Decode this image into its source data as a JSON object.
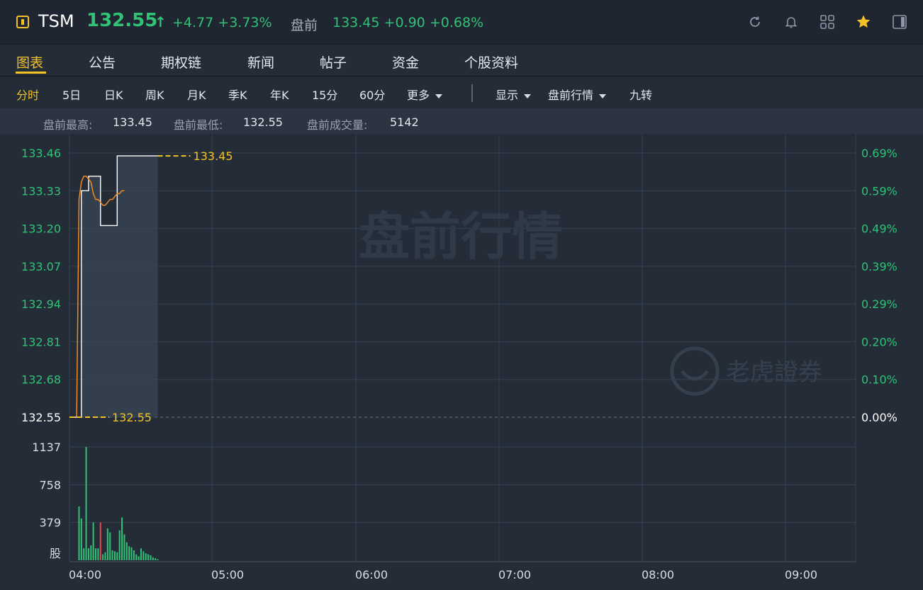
{
  "header": {
    "ticker": "TSM",
    "price": "132.55",
    "arrow": "↑",
    "change": "+4.77",
    "change_pct": "+3.73%",
    "premarket_label": "盘前",
    "premarket_price": "133.45",
    "premarket_change": "+0.90",
    "premarket_change_pct": "+0.68%",
    "icons": [
      "refresh-icon",
      "bell-icon",
      "grid-icon",
      "star-icon",
      "panel-icon"
    ]
  },
  "nav": {
    "tabs": [
      "图表",
      "公告",
      "期权链",
      "新闻",
      "帖子",
      "资金",
      "个股资料"
    ],
    "active": "图表"
  },
  "periods": {
    "items": [
      "分时",
      "5日",
      "日K",
      "周K",
      "月K",
      "季K",
      "年K",
      "15分",
      "60分"
    ],
    "more": "更多",
    "display": "显示",
    "session": "盘前行情",
    "nine_turn": "九转"
  },
  "stats": {
    "high_label": "盘前最高:",
    "high": "133.45",
    "low_label": "盘前最低:",
    "low": "132.55",
    "volume_label": "盘前成交量:",
    "volume": "5142"
  },
  "watermark": {
    "session": "盘前行情",
    "brand": "老虎證券"
  },
  "colors": {
    "up": "#30c275",
    "down": "#e8484e",
    "accent": "#f3c325",
    "price_line": "#ffffff",
    "avg_line": "#f08a24"
  },
  "chart_data": {
    "type": "line",
    "x_ticks": [
      "04:00",
      "05:00",
      "06:00",
      "07:00",
      "08:00",
      "09:00"
    ],
    "x_range": [
      "04:00",
      "09:30"
    ],
    "price_ylim": [
      132.55,
      133.46
    ],
    "price_ticks": [
      "133.46",
      "133.33",
      "133.20",
      "133.07",
      "132.94",
      "132.81",
      "132.68",
      "132.55"
    ],
    "pct_ticks": [
      "0.69%",
      "0.59%",
      "0.49%",
      "0.39%",
      "0.29%",
      "0.20%",
      "0.10%",
      "0.00%"
    ],
    "high_marker": "133.45",
    "low_marker": "132.55",
    "price_series": {
      "x_min": [
        0,
        1,
        3,
        4,
        5,
        7,
        8,
        9,
        13,
        14,
        15,
        19,
        20,
        21,
        22,
        23,
        24,
        25,
        26,
        27,
        28,
        29,
        30,
        31,
        32,
        33,
        34,
        35,
        36,
        37
      ],
      "y": [
        132.55,
        132.55,
        132.55,
        132.55,
        133.33,
        133.33,
        133.38,
        133.38,
        133.21,
        133.21,
        133.21,
        133.21,
        133.45,
        133.45,
        133.45,
        133.45,
        133.45,
        133.45,
        133.45,
        133.45,
        133.45,
        133.45,
        133.45,
        133.45,
        133.45,
        133.45,
        133.45,
        133.45,
        133.45,
        133.45
      ]
    },
    "avg_series": {
      "x_min": [
        3,
        4,
        5,
        6,
        7,
        8,
        9,
        10,
        11,
        12,
        13,
        14,
        15,
        16,
        17,
        18,
        19,
        20,
        21,
        22,
        23
      ],
      "y": [
        132.55,
        133.3,
        133.36,
        133.38,
        133.38,
        133.37,
        133.36,
        133.32,
        133.3,
        133.3,
        133.29,
        133.28,
        133.28,
        133.29,
        133.3,
        133.3,
        133.31,
        133.32,
        133.32,
        133.33,
        133.33
      ]
    },
    "volume_ticks": [
      "1137",
      "758",
      "379"
    ],
    "volume_unit": "股",
    "volume_ylim": [
      0,
      1137
    ],
    "volume": {
      "x_min": [
        3,
        4,
        5,
        6,
        7,
        8,
        9,
        10,
        11,
        12,
        13,
        14,
        15,
        16,
        17,
        18,
        19,
        20,
        21,
        22,
        23,
        24,
        25,
        26,
        27,
        28,
        29,
        30,
        31,
        32,
        33,
        34,
        35,
        36,
        37
      ],
      "values": [
        0,
        540,
        420,
        120,
        1137,
        120,
        150,
        380,
        120,
        120,
        380,
        60,
        80,
        320,
        280,
        100,
        90,
        80,
        300,
        430,
        260,
        180,
        140,
        130,
        100,
        60,
        40,
        120,
        90,
        70,
        60,
        50,
        30,
        20,
        10
      ],
      "down_index": 10
    }
  }
}
